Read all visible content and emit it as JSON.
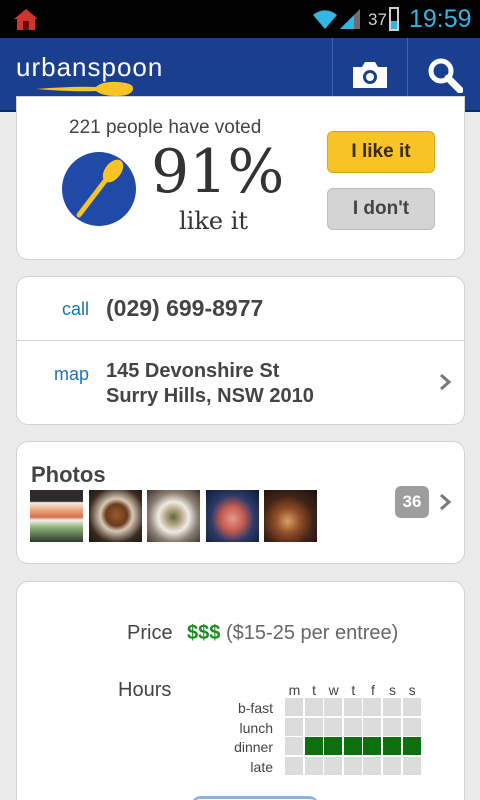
{
  "statusbar": {
    "battery": "37",
    "time": "19:59"
  },
  "header": {
    "logo": "urbanspoon"
  },
  "vote": {
    "count_text": "221 people have voted",
    "percent": "91%",
    "like_text": "like it",
    "like_button": "I like it",
    "dont_button": "I don't"
  },
  "contact": {
    "call_label": "call",
    "phone": "(029) 699-8977",
    "map_label": "map",
    "address_line1": "145 Devonshire St",
    "address_line2": "Surry Hills, NSW 2010"
  },
  "photos": {
    "title": "Photos",
    "count": "36"
  },
  "info": {
    "price_label": "Price",
    "price_symbol": "$$$",
    "price_range": "($15-25 per entree)",
    "hours_label": "Hours",
    "days": [
      "m",
      "t",
      "w",
      "t",
      "f",
      "s",
      "s"
    ],
    "meals": [
      "b-fast",
      "lunch",
      "dinner",
      "late"
    ],
    "open": {
      "b-fast": [
        false,
        false,
        false,
        false,
        false,
        false,
        false
      ],
      "lunch": [
        false,
        false,
        false,
        false,
        false,
        false,
        false
      ],
      "dinner": [
        false,
        true,
        true,
        true,
        true,
        true,
        true
      ],
      "late": [
        false,
        false,
        false,
        false,
        false,
        false,
        false
      ]
    }
  },
  "colors": {
    "header": "#1b3f8f",
    "accent_yellow": "#f7c325",
    "link_blue": "#1a73b8",
    "price_green": "#1e8c1e",
    "hours_green": "#0d6f0d"
  }
}
